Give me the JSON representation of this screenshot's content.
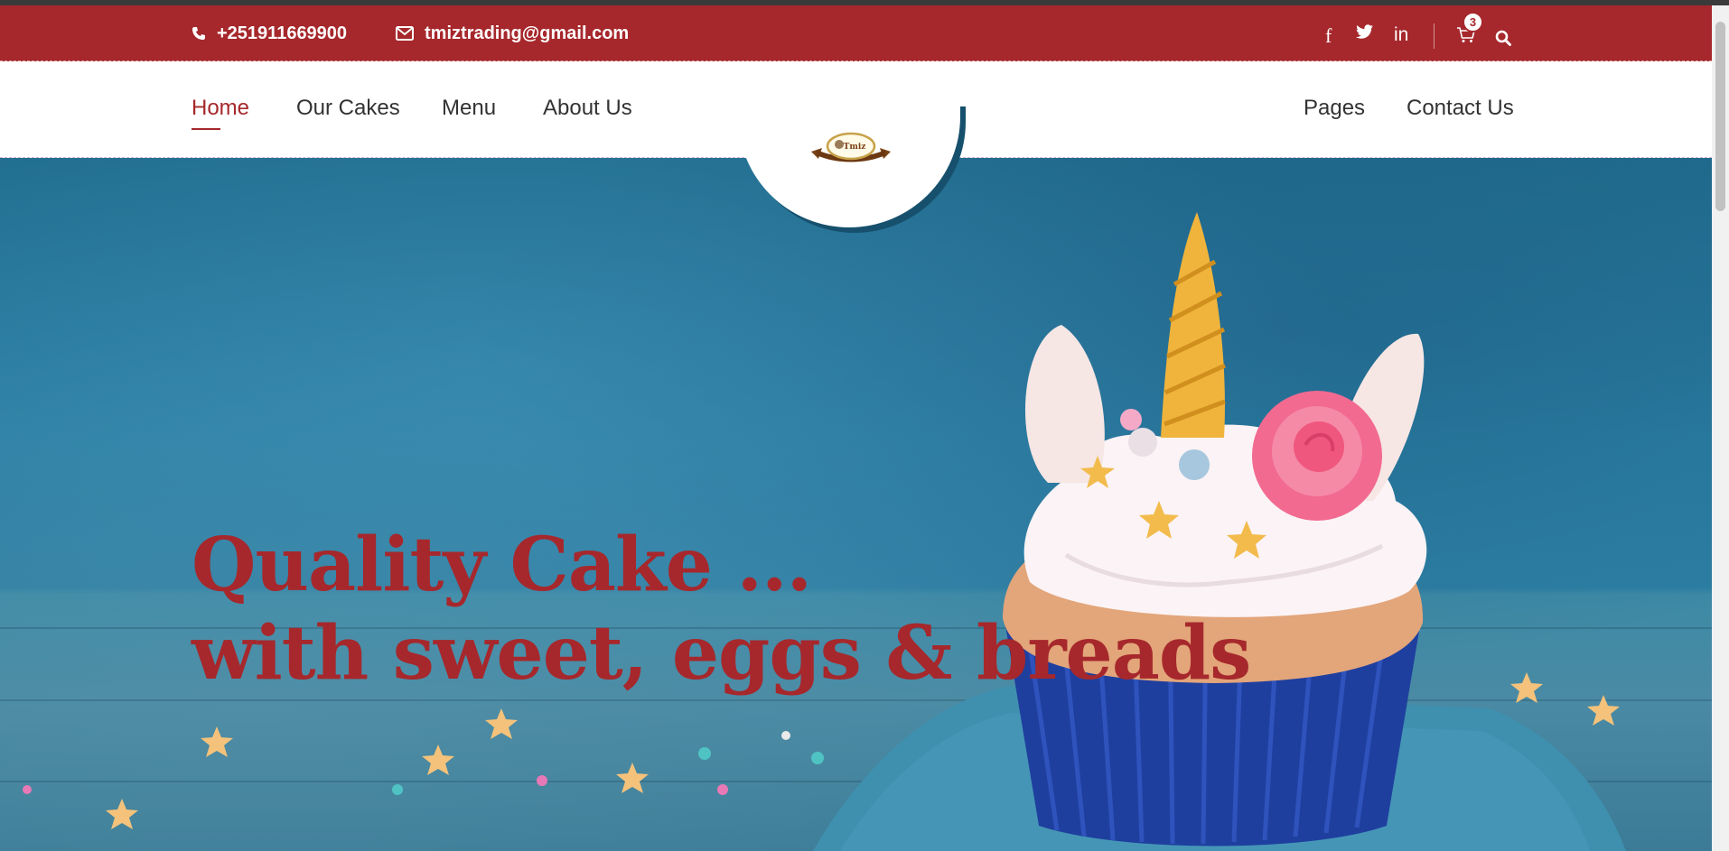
{
  "topbar": {
    "phone": "+251911669900",
    "email": "tmiztrading@gmail.com",
    "cart_count": "3",
    "bg_color": "#a6282c"
  },
  "icons": [
    "phone-icon",
    "envelope-icon",
    "facebook-icon",
    "twitter-icon",
    "linkedin-icon",
    "cart-icon",
    "search-icon"
  ],
  "nav": {
    "left": [
      "Home",
      "Our Cakes",
      "Menu",
      "About Us"
    ],
    "right": [
      "Pages",
      "Contact Us"
    ],
    "active": "Home"
  },
  "logo": {
    "text": "Tmiz"
  },
  "hero": {
    "line1": "Quality Cake ...",
    "line2": "with sweet, eggs & breads",
    "text_color": "#a6282c"
  }
}
